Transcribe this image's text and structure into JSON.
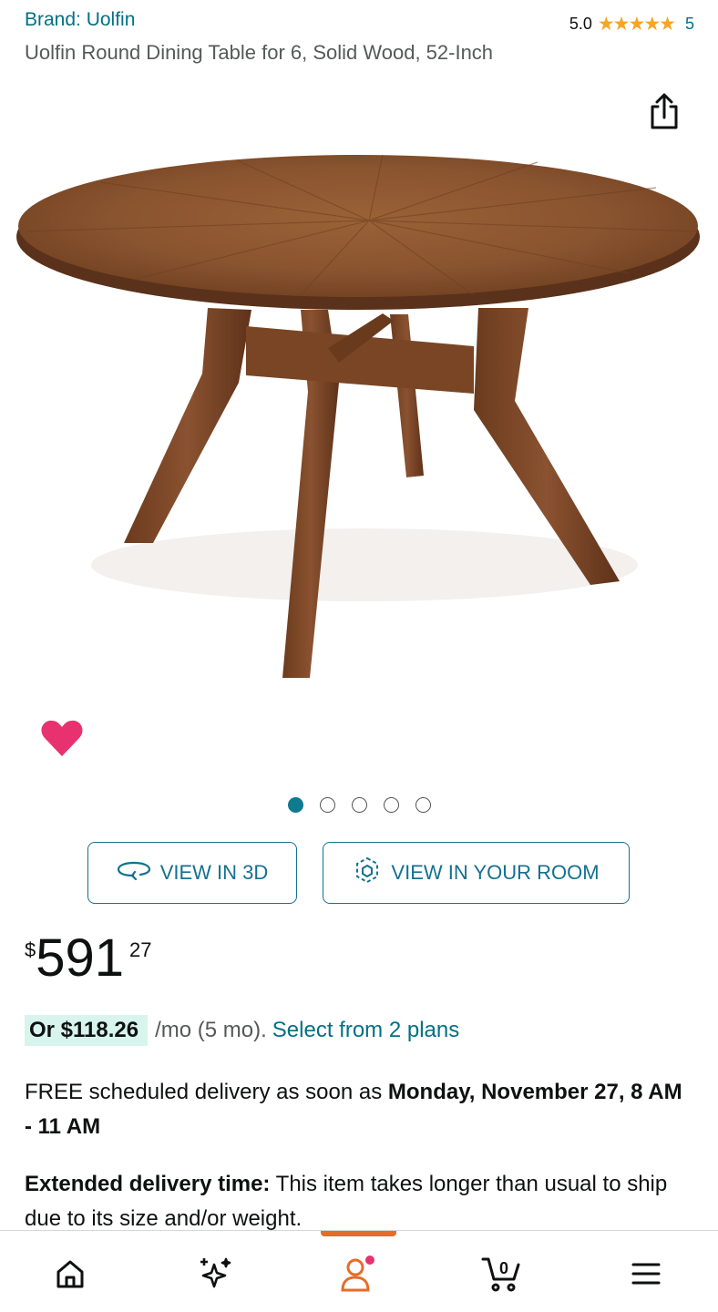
{
  "header": {
    "brand": "Brand: Uolfin",
    "rating_value": "5.0",
    "stars": "★★★★★",
    "rating_count": "5",
    "title": "Uolfin Round Dining Table for 6, Solid Wood, 52-Inch"
  },
  "gallery": {
    "image_count": 5,
    "active_index": 0
  },
  "buttons": {
    "view_3d": "VIEW IN 3D",
    "view_room": "VIEW IN YOUR ROOM"
  },
  "price": {
    "symbol": "$",
    "whole": "591",
    "fraction": "27"
  },
  "installment": {
    "amount": "Or $118.26",
    "term": "/mo (5 mo).",
    "link": "Select from 2 plans"
  },
  "delivery": {
    "prefix": "FREE scheduled delivery as soon as ",
    "date": "Monday, November 27, 8 AM - 11 AM"
  },
  "extended": {
    "label": "Extended delivery time:",
    "text": " This item takes longer than usual to ship due to its size and/or weight."
  },
  "bottom_nav": {
    "items": [
      "home-icon",
      "sparkle-icon",
      "account-icon",
      "cart-icon",
      "menu-icon"
    ],
    "cart_count": "0",
    "active": "account-icon"
  },
  "colors": {
    "link": "#007185",
    "accent": "#147191",
    "star": "#f5a623",
    "heart": "#e8326f",
    "active_tab": "#e46d2b",
    "installment_bg": "#d7f5ec"
  }
}
